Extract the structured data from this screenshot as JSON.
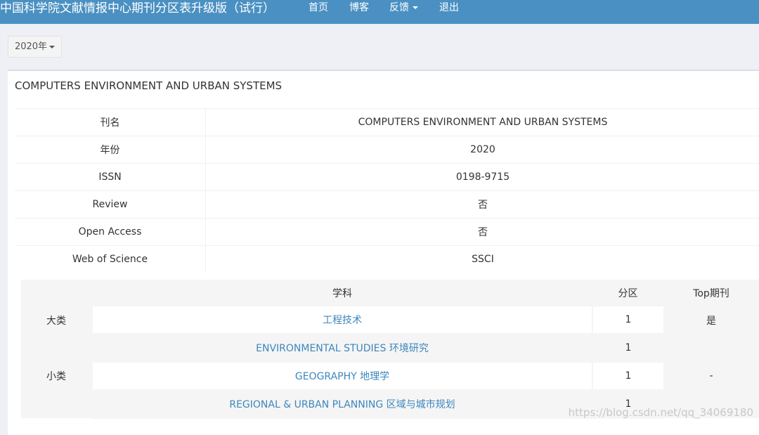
{
  "header": {
    "brand": "中国科学院文献情报中心期刊分区表升级版（试行）",
    "nav": {
      "home": "首页",
      "blog": "博客",
      "feedback": "反馈",
      "logout": "退出"
    }
  },
  "year_selector": {
    "label": "2020年"
  },
  "panel": {
    "title": "COMPUTERS ENVIRONMENT AND URBAN SYSTEMS",
    "info": [
      {
        "label": "刊名",
        "value": "COMPUTERS ENVIRONMENT AND URBAN SYSTEMS"
      },
      {
        "label": "年份",
        "value": "2020"
      },
      {
        "label": "ISSN",
        "value": "0198-9715"
      },
      {
        "label": "Review",
        "value": "否"
      },
      {
        "label": "Open Access",
        "value": "否"
      },
      {
        "label": "Web of Science",
        "value": "SSCI"
      }
    ],
    "categories": {
      "headers": {
        "subject": "学科",
        "zone": "分区",
        "top": "Top期刊"
      },
      "major": {
        "type": "大类",
        "subject": "工程技术",
        "zone": "1",
        "top": "是"
      },
      "minor": {
        "type": "小类",
        "top": "-",
        "rows": [
          {
            "subject": "ENVIRONMENTAL STUDIES 环境研究",
            "zone": "1"
          },
          {
            "subject": "GEOGRAPHY 地理学",
            "zone": "1"
          },
          {
            "subject": "REGIONAL & URBAN PLANNING 区域与城市规划",
            "zone": "1"
          }
        ]
      }
    }
  },
  "watermark": "https://blog.csdn.net/qq_34069180"
}
